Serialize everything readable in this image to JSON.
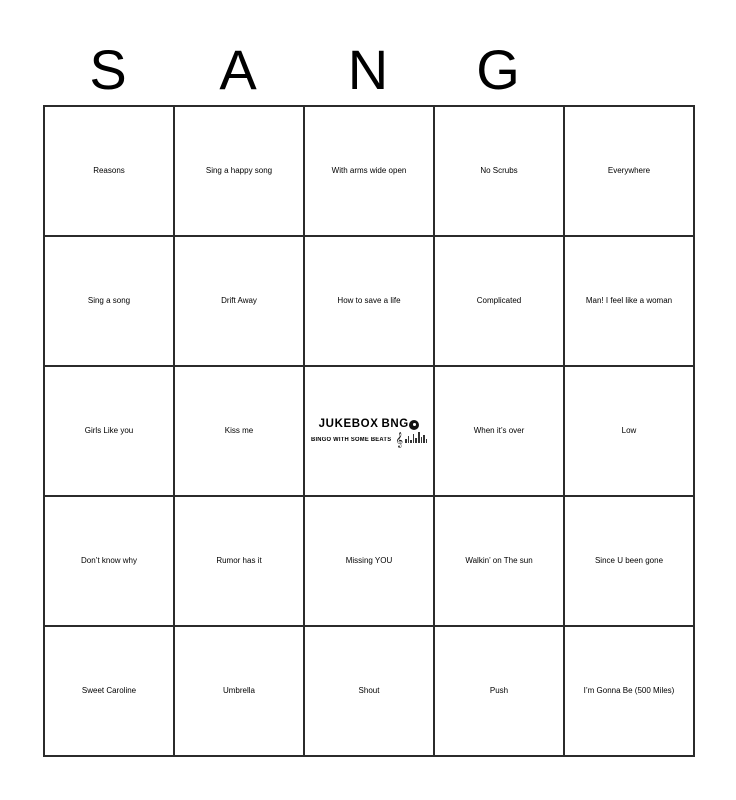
{
  "card": {
    "title": "SANG",
    "header_letters": [
      "S",
      "A",
      "N",
      "G",
      ""
    ],
    "columns": 5,
    "rows": 5,
    "grid_line_color": "#2b2b2b",
    "background_color": "#ffffff",
    "text_color": "#000000"
  },
  "logo": {
    "name": "jukebox-bingo-logo",
    "word_one": "JUKEBOX",
    "word_two": "B",
    "word_three": "NG",
    "tagline": "BINGO WITH SOME BEATS",
    "record_icon": "vinyl-record-icon",
    "clef_icon": "treble-clef-icon",
    "equalizer_icon": "equalizer-bars-icon"
  },
  "cells": [
    {
      "row": 1,
      "col": 1,
      "text": "Reasons",
      "size": "s"
    },
    {
      "row": 1,
      "col": 2,
      "text": "Sing a happy song",
      "size": "l"
    },
    {
      "row": 1,
      "col": 3,
      "text": "With arms wide open",
      "size": "m"
    },
    {
      "row": 1,
      "col": 4,
      "text": "No Scrubs",
      "size": "xl"
    },
    {
      "row": 1,
      "col": 5,
      "text": "Everywhere",
      "size": "s"
    },
    {
      "row": 2,
      "col": 1,
      "text": "Sing a song",
      "size": "xl"
    },
    {
      "row": 2,
      "col": 2,
      "text": "Drift Away",
      "size": "xxl"
    },
    {
      "row": 2,
      "col": 3,
      "text": "How to save a life",
      "size": "l"
    },
    {
      "row": 2,
      "col": 4,
      "text": "Complicated",
      "size": "xs"
    },
    {
      "row": 2,
      "col": 5,
      "text": "Man! I feel like a woman",
      "size": "m"
    },
    {
      "row": 3,
      "col": 1,
      "text": "Girls Like you",
      "size": "l"
    },
    {
      "row": 3,
      "col": 2,
      "text": "Kiss me",
      "size": "xxl"
    },
    {
      "row": 3,
      "col": 3,
      "text": "",
      "size": "m",
      "free_space": true
    },
    {
      "row": 3,
      "col": 4,
      "text": "When it’s over",
      "size": "l"
    },
    {
      "row": 3,
      "col": 5,
      "text": "Low",
      "size": "xxl"
    },
    {
      "row": 4,
      "col": 1,
      "text": "Don’t know why",
      "size": "l"
    },
    {
      "row": 4,
      "col": 2,
      "text": "Rumor has it",
      "size": "xl"
    },
    {
      "row": 4,
      "col": 3,
      "text": "Missing YOU",
      "size": "xl"
    },
    {
      "row": 4,
      "col": 4,
      "text": "Walkin’ on The sun",
      "size": "l"
    },
    {
      "row": 4,
      "col": 5,
      "text": "Since U been gone",
      "size": "l"
    },
    {
      "row": 5,
      "col": 1,
      "text": "Sweet Caroline",
      "size": "l"
    },
    {
      "row": 5,
      "col": 2,
      "text": "Umbrella",
      "size": "s"
    },
    {
      "row": 5,
      "col": 3,
      "text": "Shout",
      "size": "xxl"
    },
    {
      "row": 5,
      "col": 4,
      "text": "Push",
      "size": "xxl"
    },
    {
      "row": 5,
      "col": 5,
      "text": "I’m Gonna Be (500 Miles)",
      "size": "s"
    }
  ]
}
